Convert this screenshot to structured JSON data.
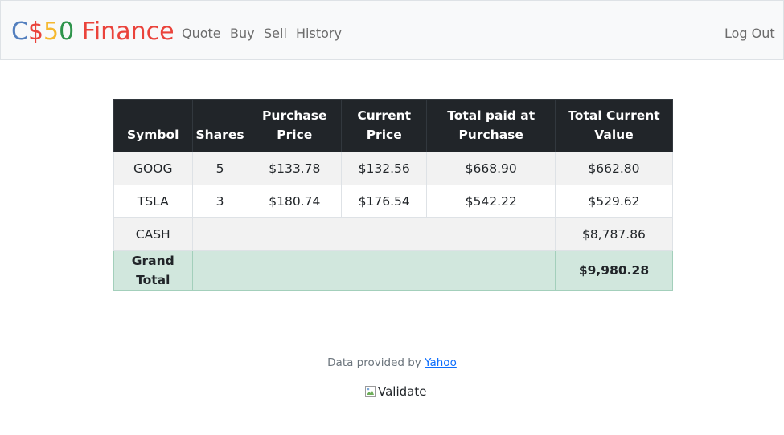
{
  "navbar": {
    "brand": {
      "part1": "C",
      "part2": "$",
      "part3": "5",
      "part4": "0",
      "part5": " Finance"
    },
    "links": [
      "Quote",
      "Buy",
      "Sell",
      "History"
    ],
    "logout": "Log Out"
  },
  "table": {
    "headers": {
      "symbol": "Symbol",
      "shares": "Shares",
      "purchase_price": [
        "Purchase",
        "Price"
      ],
      "current_price": [
        "Current",
        "Price"
      ],
      "total_paid": [
        "Total paid at",
        "Purchase"
      ],
      "total_value": [
        "Total Current",
        "Value"
      ]
    },
    "rows": [
      {
        "symbol": "GOOG",
        "shares": "5",
        "purchase_price": "$133.78",
        "current_price": "$132.56",
        "total_paid": "$668.90",
        "total_value": "$662.80"
      },
      {
        "symbol": "TSLA",
        "shares": "3",
        "purchase_price": "$180.74",
        "current_price": "$176.54",
        "total_paid": "$542.22",
        "total_value": "$529.62"
      }
    ],
    "cash": {
      "label": "CASH",
      "value": "$8,787.86"
    },
    "grand_total": {
      "label": [
        "Grand",
        "Total"
      ],
      "value": "$9,980.28"
    }
  },
  "footer": {
    "prefix": "Data provided by ",
    "link": "Yahoo",
    "validate_alt": "Validate"
  },
  "colors": {
    "brand_blue": "#537fbe",
    "brand_red": "#ea433b",
    "brand_yellow": "#f5b82e",
    "brand_green": "#2e944b",
    "table_header_bg": "#212529",
    "total_row_bg": "#d1e7dd"
  },
  "icons": {
    "validate_image": "broken-image-icon"
  }
}
